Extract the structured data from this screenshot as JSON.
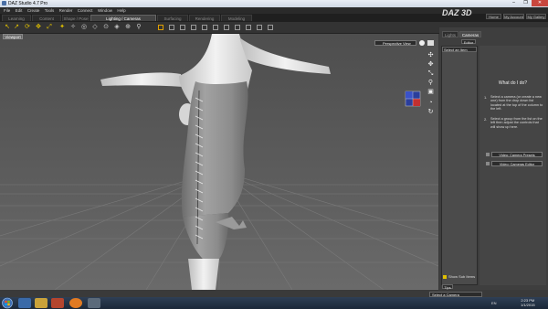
{
  "window": {
    "title": "DAZ Studio 4.7 Pro",
    "controls": [
      "–",
      "❐",
      "✕"
    ]
  },
  "menu": [
    "File",
    "Edit",
    "Create",
    "Tools",
    "Render",
    "Connect",
    "Window",
    "Help"
  ],
  "tabs": [
    {
      "label": "Learning Center"
    },
    {
      "label": "Content Library"
    },
    {
      "label": "Shape / Pose"
    },
    {
      "label": "Lighting / Cameras"
    },
    {
      "label": "Surfacing"
    },
    {
      "label": "Rendering"
    },
    {
      "label": "Modeling"
    }
  ],
  "active_tab": "Lighting / Cameras",
  "brand": "DAZ 3D",
  "top_buttons": [
    "Home",
    "My Account",
    "My Gallery"
  ],
  "viewport": {
    "tab_label": "Viewport",
    "camera_select": "Perspective View"
  },
  "right_panel": {
    "tabs": [
      "Lights",
      "Cameras"
    ],
    "active_tab": "Cameras",
    "editor_tab": "Editor",
    "item_select": "Select an Item",
    "help_title": "What do I do?",
    "steps": [
      {
        "num": "1.",
        "text": "Select a camera (or create a new one) from the drop down list located at the top of the column to the left."
      },
      {
        "num": "2.",
        "text": "Select a group from the list on the left then adjust the controls that will show up here."
      }
    ],
    "buttons": [
      "Video: Camera Presets",
      "Video: Cameras Editor"
    ],
    "show_sub_items": "Show Sub Items",
    "bottom_tab": "Tips",
    "bottom_select": "Select a Camera"
  },
  "taskbar": {
    "tray_lang": "EN",
    "time": "2:23 PM",
    "date": "1/1/2015"
  },
  "colors": {
    "accent": "#e0c000",
    "viewport_bg": "#5a5a5a",
    "panel_bg": "#3e3e3e"
  }
}
